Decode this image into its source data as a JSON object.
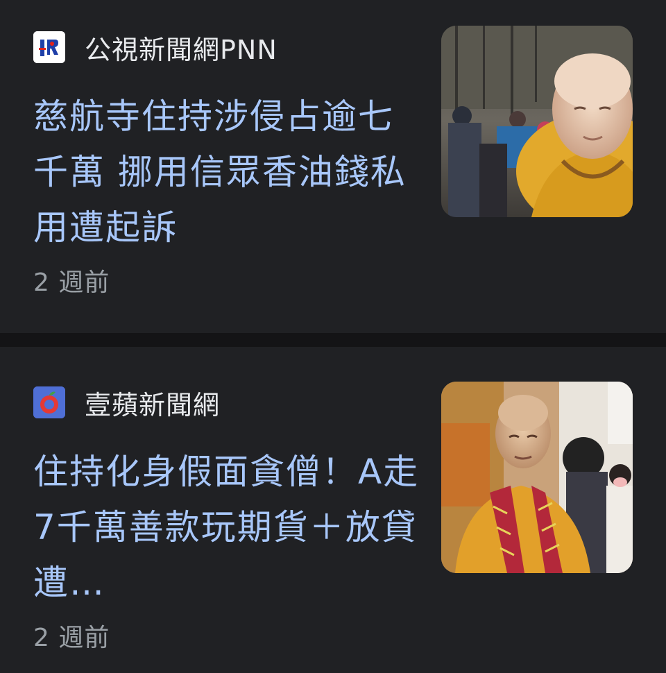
{
  "articles": [
    {
      "source": "公視新聞網PNN",
      "source_logo": "pts-logo-icon",
      "headline": "慈航寺住持涉侵占逾七千萬 挪用信眾香油錢私用遭起訴",
      "time": "2 週前",
      "thumbnail": "monk-portrait-thumbnail"
    },
    {
      "source": "壹蘋新聞網",
      "source_logo": "nextapple-logo-icon",
      "headline": "住持化身假面貪僧！A走7千萬善款玩期貨＋放貸 遭…",
      "time": "2 週前",
      "thumbnail": "monk-in-robe-thumbnail"
    }
  ],
  "colors": {
    "background": "#202124",
    "headline": "#a8c7fa",
    "source": "#e8eaed",
    "timestamp": "#9aa0a6"
  }
}
